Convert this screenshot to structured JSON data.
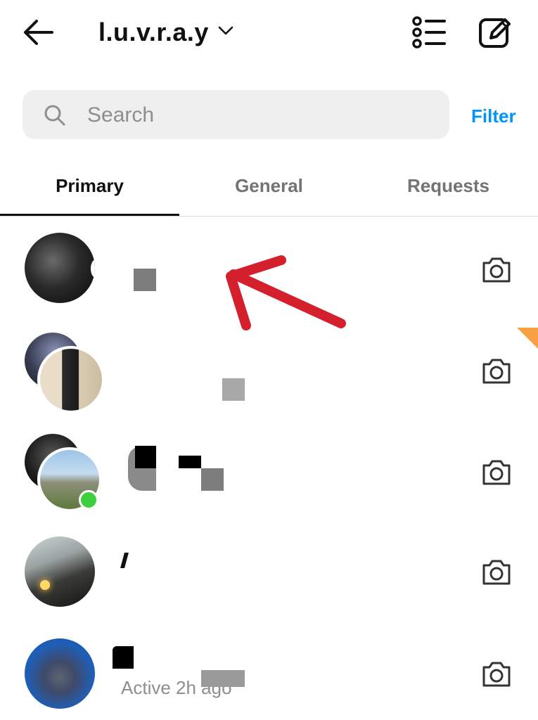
{
  "header": {
    "username": "l.u.v.r.a.y"
  },
  "search": {
    "placeholder": "Search"
  },
  "filter_label": "Filter",
  "tabs": [
    {
      "label": "Primary"
    },
    {
      "label": "General"
    },
    {
      "label": "Requests"
    }
  ],
  "threads": [
    {
      "status": ""
    },
    {
      "status": ""
    },
    {
      "status": ""
    },
    {
      "status": ""
    },
    {
      "status": "Active 2h ago"
    }
  ],
  "colors": {
    "accent": "#0095f6",
    "online": "#3ecf3e",
    "annotation_arrow": "#d4202c"
  }
}
